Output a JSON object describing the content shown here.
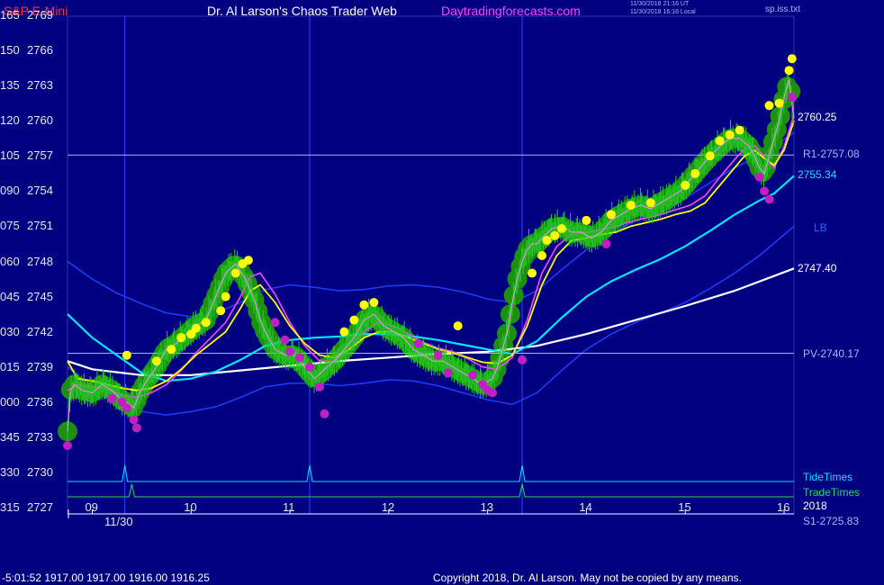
{
  "header": {
    "symbol": "S&P E-Mini",
    "title": "Dr. Al Larson's Chaos Trader Web",
    "site": "Daytradingforecasts.com",
    "stamp1": "11/30/2018 21:16 UT",
    "stamp2": "11/30/2018 16:16 Local",
    "file": "sp.iss.txt"
  },
  "colors": {
    "background": "#000080",
    "price": "#22cc22",
    "fast_avg": "#ffff00",
    "mid_avg": "#ff44ff",
    "slow_avg": "#00e5ff",
    "long_avg": "#ffffff",
    "band": "#1e3cff",
    "tide": "#00e5ff",
    "trade": "#22dd55",
    "level_line": "#b0b0ff"
  },
  "right_labels": {
    "last": "2760.25",
    "r1": "R1-2757.08",
    "cyan": "2755.34",
    "lb": "LB",
    "white": "2747.40",
    "pv": "PV-2740.17",
    "tide": "TideTimes",
    "trade": "TradeTimes",
    "year": "2018",
    "s1": "S1-2725.83"
  },
  "footer": {
    "readout": "-5:01:52  1917.00 1917.00 1916.00 1916.25",
    "copyright": "Copyright 2018, Dr. Al Larson. May not be copied by any means."
  },
  "chart_data": {
    "type": "line",
    "title": "S&P E-Mini",
    "x_date": "11/30",
    "x_hours": [
      "09",
      "10",
      "11",
      "12",
      "13",
      "14",
      "15",
      "16"
    ],
    "y_ticks": [
      {
        "deg": "165",
        "price": 2769
      },
      {
        "deg": "150",
        "price": 2766
      },
      {
        "deg": "135",
        "price": 2763
      },
      {
        "deg": "120",
        "price": 2760
      },
      {
        "deg": "105",
        "price": 2757
      },
      {
        "deg": "090",
        "price": 2754
      },
      {
        "deg": "075",
        "price": 2751
      },
      {
        "deg": "060",
        "price": 2748
      },
      {
        "deg": "045",
        "price": 2745
      },
      {
        "deg": "030",
        "price": 2742
      },
      {
        "deg": "015",
        "price": 2739
      },
      {
        "deg": "000",
        "price": 2736
      },
      {
        "deg": "345",
        "price": 2733
      },
      {
        "deg": "330",
        "price": 2730
      },
      {
        "deg": "315",
        "price": 2727
      }
    ],
    "ylim": [
      2727,
      2769
    ],
    "xlim": [
      8.75,
      16.1
    ],
    "levels": [
      {
        "name": "R1",
        "price": 2757.08
      },
      {
        "name": "PV",
        "price": 2740.17
      },
      {
        "name": "S1",
        "price": 2725.83
      }
    ],
    "tide_times": [
      9.33,
      11.2,
      13.35
    ],
    "trade_times": [
      9.4,
      13.35
    ],
    "series": [
      {
        "role": "price",
        "x": [
          8.75,
          8.78,
          8.82,
          8.9,
          9.0,
          9.1,
          9.2,
          9.3,
          9.38,
          9.42,
          9.48,
          9.55,
          9.65,
          9.75,
          9.85,
          9.95,
          10.05,
          10.15,
          10.25,
          10.35,
          10.45,
          10.55,
          10.6,
          10.65,
          10.7,
          10.75,
          10.85,
          10.95,
          11.05,
          11.1,
          11.15,
          11.2,
          11.25,
          11.35,
          11.45,
          11.55,
          11.65,
          11.75,
          11.85,
          11.95,
          12.05,
          12.15,
          12.25,
          12.35,
          12.45,
          12.55,
          12.65,
          12.75,
          12.85,
          12.95,
          13.05,
          13.1,
          13.15,
          13.2,
          13.25,
          13.3,
          13.35,
          13.4,
          13.45,
          13.5,
          13.55,
          13.65,
          13.75,
          13.85,
          13.95,
          14.05,
          14.15,
          14.25,
          14.35,
          14.45,
          14.55,
          14.65,
          14.75,
          14.85,
          14.95,
          15.05,
          15.15,
          15.25,
          15.35,
          15.45,
          15.55,
          15.65,
          15.7,
          15.75,
          15.8,
          15.85,
          15.9,
          15.95,
          16.0,
          16.05,
          16.1
        ],
        "y": [
          2733.5,
          2737,
          2737.5,
          2737,
          2736.8,
          2737.5,
          2737,
          2736.2,
          2735.8,
          2735.5,
          2736.8,
          2737.8,
          2739,
          2740.5,
          2741,
          2741.8,
          2742.5,
          2743,
          2745,
          2747,
          2747.8,
          2746.5,
          2745.5,
          2744.5,
          2743,
          2742,
          2740.5,
          2740,
          2740,
          2739.5,
          2739,
          2738.5,
          2738,
          2738.8,
          2739.5,
          2740.5,
          2741.5,
          2743,
          2743.5,
          2742.5,
          2742,
          2741.5,
          2740.5,
          2740,
          2739.5,
          2739.5,
          2739,
          2738.5,
          2738,
          2737.5,
          2738,
          2739,
          2740.5,
          2742,
          2744.5,
          2746.5,
          2748,
          2749,
          2749.5,
          2749.5,
          2750,
          2750.8,
          2751,
          2750.5,
          2750.5,
          2750,
          2750.5,
          2751.5,
          2752,
          2752.5,
          2752.8,
          2752.5,
          2753,
          2753.5,
          2754,
          2755,
          2756,
          2757,
          2757.8,
          2758.5,
          2758.5,
          2757.8,
          2757,
          2756,
          2755.5,
          2757,
          2758.5,
          2760,
          2762,
          2763.5,
          2760.2
        ]
      },
      {
        "role": "fast_avg",
        "x": [
          8.75,
          8.85,
          9.0,
          9.15,
          9.3,
          9.45,
          9.6,
          9.75,
          9.9,
          10.05,
          10.2,
          10.35,
          10.5,
          10.6,
          10.7,
          10.85,
          11.0,
          11.15,
          11.3,
          11.45,
          11.6,
          11.75,
          11.9,
          12.05,
          12.2,
          12.35,
          12.5,
          12.65,
          12.8,
          12.95,
          13.1,
          13.25,
          13.4,
          13.55,
          13.7,
          13.85,
          14.0,
          14.15,
          14.3,
          14.45,
          14.6,
          14.75,
          14.9,
          15.05,
          15.2,
          15.35,
          15.5,
          15.6,
          15.7,
          15.8,
          15.9,
          16.0,
          16.1
        ],
        "y": [
          2739.5,
          2738,
          2737.8,
          2737.5,
          2737.2,
          2737,
          2737.2,
          2737.8,
          2738.8,
          2740,
          2741,
          2742,
          2744,
          2745.5,
          2746,
          2744.5,
          2742.5,
          2741,
          2740,
          2739.8,
          2740.5,
          2741.5,
          2742,
          2742,
          2741.5,
          2741,
          2740.5,
          2740.2,
          2739.8,
          2739.4,
          2739.3,
          2740,
          2742.5,
          2746,
          2748.5,
          2749.8,
          2750,
          2750.3,
          2750.5,
          2751,
          2751.3,
          2751.6,
          2752,
          2752.3,
          2753,
          2754.5,
          2756,
          2757,
          2757.5,
          2756.8,
          2756.2,
          2757.5,
          2760
        ]
      },
      {
        "role": "mid_avg",
        "x": [
          8.75,
          8.85,
          9.0,
          9.15,
          9.3,
          9.45,
          9.6,
          9.75,
          9.9,
          10.05,
          10.2,
          10.35,
          10.5,
          10.6,
          10.7,
          10.85,
          11.0,
          11.15,
          11.3,
          11.45,
          11.6,
          11.75,
          11.9,
          12.05,
          12.2,
          12.35,
          12.5,
          12.65,
          12.8,
          12.95,
          13.1,
          13.25,
          13.4,
          13.55,
          13.7,
          13.85,
          14.0,
          14.15,
          14.3,
          14.45,
          14.6,
          14.75,
          14.9,
          15.05,
          15.2,
          15.35,
          15.5,
          15.6,
          15.7,
          15.8,
          15.9,
          16.0,
          16.1
        ],
        "y": [
          2737,
          2737.5,
          2737.3,
          2737.1,
          2736.6,
          2736.4,
          2736.8,
          2737.5,
          2738.7,
          2740.2,
          2741.5,
          2742.8,
          2745,
          2746.7,
          2747,
          2745.2,
          2742.8,
          2740.8,
          2739.5,
          2739.5,
          2740.5,
          2742,
          2742.8,
          2742.5,
          2741.8,
          2741.1,
          2740.6,
          2740.3,
          2739.7,
          2739,
          2738.8,
          2739.8,
          2743,
          2747,
          2749.3,
          2750.3,
          2750.5,
          2750.7,
          2751,
          2751.4,
          2751.7,
          2752,
          2752.4,
          2752.8,
          2753.6,
          2755.2,
          2756.7,
          2757.6,
          2757.9,
          2756.9,
          2756,
          2757.8,
          2760.5
        ]
      },
      {
        "role": "slow_avg",
        "x": [
          8.75,
          9.0,
          9.25,
          9.5,
          9.75,
          10.0,
          10.25,
          10.5,
          10.75,
          11.0,
          11.25,
          11.5,
          11.75,
          12.0,
          12.25,
          12.5,
          12.75,
          13.0,
          13.25,
          13.5,
          13.75,
          14.0,
          14.25,
          14.5,
          14.75,
          15.0,
          15.25,
          15.5,
          15.75,
          15.9,
          16.1
        ],
        "y": [
          2743.5,
          2741.5,
          2740,
          2738.5,
          2737.8,
          2738,
          2738.6,
          2739.6,
          2740.8,
          2741.3,
          2741.5,
          2741.6,
          2741.8,
          2741.8,
          2741.6,
          2741.3,
          2740.9,
          2740.5,
          2740.1,
          2741.2,
          2743.2,
          2745,
          2746.3,
          2747.3,
          2748.2,
          2749.3,
          2750.6,
          2752,
          2753.2,
          2753.8,
          2755.3
        ]
      },
      {
        "role": "long_avg",
        "x": [
          8.75,
          9.0,
          9.5,
          10.0,
          10.5,
          11.0,
          11.5,
          12.0,
          12.5,
          13.0,
          13.5,
          14.0,
          14.5,
          15.0,
          15.5,
          16.1
        ],
        "y": [
          2739.5,
          2738.8,
          2738.3,
          2738.3,
          2738.7,
          2739.1,
          2739.5,
          2739.8,
          2740.1,
          2740.3,
          2740.8,
          2741.8,
          2743,
          2744.2,
          2745.5,
          2747.4
        ]
      },
      {
        "role": "band_upper",
        "x": [
          8.75,
          9.0,
          9.25,
          9.5,
          9.75,
          10.0,
          10.25,
          10.5,
          10.75,
          11.0,
          11.25,
          11.5,
          11.75,
          12.0,
          12.25,
          12.5,
          12.75,
          13.0,
          13.25,
          13.5,
          13.75,
          14.0,
          14.25,
          14.5,
          14.75,
          15.0,
          15.25,
          15.5,
          15.75,
          16.1
        ],
        "y": [
          2748,
          2746.5,
          2745.3,
          2744.4,
          2743.6,
          2743.3,
          2743.6,
          2744.5,
          2745.6,
          2746,
          2745.8,
          2745.5,
          2745.6,
          2745.9,
          2746,
          2745.8,
          2745.4,
          2744.8,
          2744.5,
          2745.5,
          2747.3,
          2749,
          2750.4,
          2751.5,
          2752.4,
          2753.4,
          2754.7,
          2756,
          2757,
          2759
        ]
      },
      {
        "role": "band_lower",
        "x": [
          8.75,
          9.0,
          9.25,
          9.5,
          9.75,
          10.0,
          10.25,
          10.5,
          10.75,
          11.0,
          11.25,
          11.5,
          11.75,
          12.0,
          12.25,
          12.5,
          12.75,
          13.0,
          13.25,
          13.5,
          13.75,
          14.0,
          14.25,
          14.5,
          14.75,
          15.0,
          15.25,
          15.5,
          15.75,
          16.1
        ],
        "y": [
          2739,
          2737.3,
          2736,
          2735.2,
          2734.9,
          2735.2,
          2735.6,
          2736.4,
          2737.3,
          2737.6,
          2737.6,
          2737.4,
          2737.6,
          2737.9,
          2737.8,
          2737.4,
          2736.8,
          2736.2,
          2735.8,
          2736.8,
          2738.7,
          2740.5,
          2741.8,
          2742.8,
          2743.6,
          2744.5,
          2745.7,
          2747,
          2748.5,
          2751
        ]
      }
    ],
    "highs": [
      {
        "x": 9.35,
        "y": 2740.0
      },
      {
        "x": 9.65,
        "y": 2739.5
      },
      {
        "x": 9.8,
        "y": 2740.5
      },
      {
        "x": 9.9,
        "y": 2741.5
      },
      {
        "x": 10.0,
        "y": 2741.8
      },
      {
        "x": 10.05,
        "y": 2742.3
      },
      {
        "x": 10.15,
        "y": 2742.8
      },
      {
        "x": 10.3,
        "y": 2743.8
      },
      {
        "x": 10.35,
        "y": 2745.0
      },
      {
        "x": 10.45,
        "y": 2747.0
      },
      {
        "x": 10.52,
        "y": 2747.8
      },
      {
        "x": 10.58,
        "y": 2748.1
      },
      {
        "x": 11.55,
        "y": 2742.0
      },
      {
        "x": 11.65,
        "y": 2743.0
      },
      {
        "x": 11.75,
        "y": 2744.3
      },
      {
        "x": 11.85,
        "y": 2744.5
      },
      {
        "x": 12.7,
        "y": 2742.5
      },
      {
        "x": 13.45,
        "y": 2747.0
      },
      {
        "x": 13.55,
        "y": 2748.5
      },
      {
        "x": 13.6,
        "y": 2749.8
      },
      {
        "x": 13.68,
        "y": 2750.2
      },
      {
        "x": 13.75,
        "y": 2750.8
      },
      {
        "x": 14.0,
        "y": 2751.5
      },
      {
        "x": 14.25,
        "y": 2752.0
      },
      {
        "x": 14.45,
        "y": 2752.8
      },
      {
        "x": 14.65,
        "y": 2753.0
      },
      {
        "x": 15.0,
        "y": 2754.5
      },
      {
        "x": 15.1,
        "y": 2755.5
      },
      {
        "x": 15.25,
        "y": 2757.0
      },
      {
        "x": 15.35,
        "y": 2758.3
      },
      {
        "x": 15.45,
        "y": 2758.8
      },
      {
        "x": 15.55,
        "y": 2759.2
      },
      {
        "x": 15.85,
        "y": 2761.3
      },
      {
        "x": 15.95,
        "y": 2761.5
      },
      {
        "x": 16.05,
        "y": 2764.3
      },
      {
        "x": 16.08,
        "y": 2765.3
      }
    ],
    "lows": [
      {
        "x": 8.75,
        "y": 2732.3
      },
      {
        "x": 9.2,
        "y": 2736.3
      },
      {
        "x": 9.3,
        "y": 2736.0
      },
      {
        "x": 9.35,
        "y": 2735.5
      },
      {
        "x": 9.42,
        "y": 2734.5
      },
      {
        "x": 9.45,
        "y": 2733.8
      },
      {
        "x": 10.85,
        "y": 2742.8
      },
      {
        "x": 10.95,
        "y": 2741.3
      },
      {
        "x": 11.0,
        "y": 2740.3
      },
      {
        "x": 11.1,
        "y": 2739.8
      },
      {
        "x": 11.2,
        "y": 2739.0
      },
      {
        "x": 11.3,
        "y": 2737.3
      },
      {
        "x": 11.35,
        "y": 2735.0
      },
      {
        "x": 12.3,
        "y": 2741.0
      },
      {
        "x": 12.5,
        "y": 2740.0
      },
      {
        "x": 12.6,
        "y": 2738.5
      },
      {
        "x": 12.85,
        "y": 2738.3
      },
      {
        "x": 12.95,
        "y": 2737.5
      },
      {
        "x": 13.0,
        "y": 2737.0
      },
      {
        "x": 13.05,
        "y": 2736.8
      },
      {
        "x": 13.35,
        "y": 2739.6
      },
      {
        "x": 14.2,
        "y": 2749.5
      },
      {
        "x": 15.75,
        "y": 2755.2
      },
      {
        "x": 15.8,
        "y": 2754.0
      },
      {
        "x": 15.85,
        "y": 2753.3
      },
      {
        "x": 16.08,
        "y": 2762.0
      }
    ]
  }
}
